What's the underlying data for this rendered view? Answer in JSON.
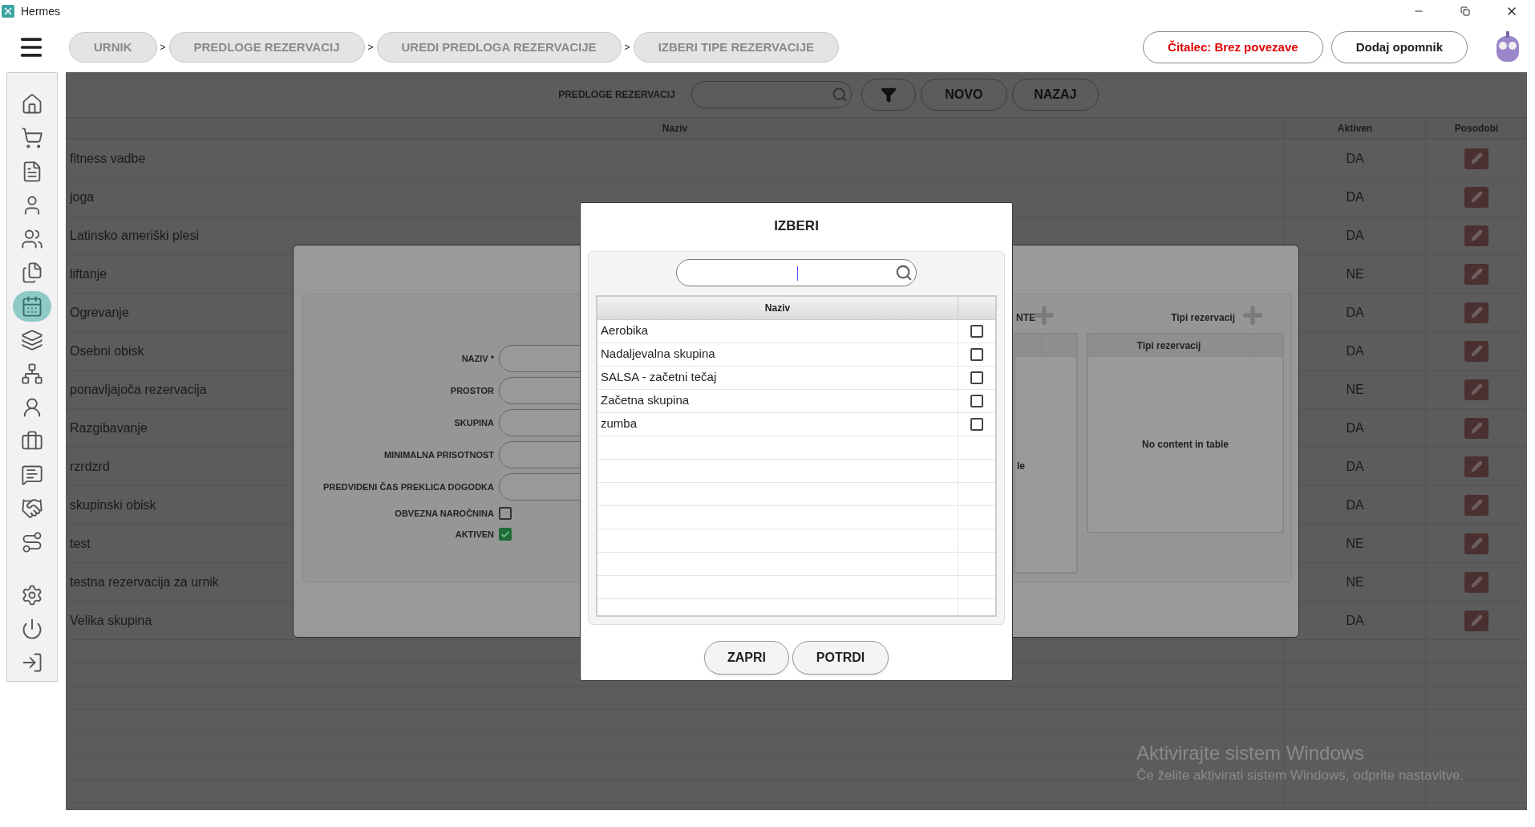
{
  "window": {
    "title": "Hermes"
  },
  "breadcrumbs": {
    "items": [
      {
        "label": "URNIK"
      },
      {
        "label": "PREDLOGE REZERVACIJ"
      },
      {
        "label": "UREDI PREDLOGA REZERVACIJE"
      },
      {
        "label": "IZBERI TIPE REZERVACIJE"
      }
    ],
    "separators": [
      ">",
      ">",
      ">"
    ]
  },
  "header_buttons": [
    {
      "label": "Čitalec: Brez povezave",
      "kind": "status"
    },
    {
      "label": "Dodaj opomnik",
      "kind": "plain"
    }
  ],
  "sidebar": {
    "items": [
      {
        "selected": false
      },
      {
        "selected": false
      },
      {
        "selected": false
      },
      {
        "selected": false
      },
      {
        "selected": false
      },
      {
        "selected": false
      },
      {
        "selected": true
      },
      {
        "selected": false
      },
      {
        "selected": false
      },
      {
        "selected": false
      },
      {
        "selected": false
      },
      {
        "selected": false
      },
      {
        "selected": false
      },
      {
        "selected": false
      },
      {
        "selected": false
      },
      {
        "selected": false
      },
      {
        "selected": false
      }
    ]
  },
  "toolbar": {
    "label": "PREDLOGE REZERVACIJ",
    "buttons": [
      "NOVO",
      "NAZAJ"
    ]
  },
  "table": {
    "columns": [
      "Naziv",
      "Aktiven",
      "Posodobi"
    ],
    "rows": [
      {
        "naziv": "fitness vadbe",
        "aktiven": "DA"
      },
      {
        "naziv": "joga",
        "aktiven": "DA"
      },
      {
        "naziv": "Latinsko ameriški plesi",
        "aktiven": "DA"
      },
      {
        "naziv": "liftanje",
        "aktiven": "NE"
      },
      {
        "naziv": "Ogrevanje",
        "aktiven": "DA"
      },
      {
        "naziv": "Osebni obisk",
        "aktiven": "DA"
      },
      {
        "naziv": "ponavljajoča rezervacija",
        "aktiven": "NE"
      },
      {
        "naziv": "Razgibavanje",
        "aktiven": "DA"
      },
      {
        "naziv": "rzrdzrd",
        "aktiven": "DA"
      },
      {
        "naziv": "skupinski obisk",
        "aktiven": "DA"
      },
      {
        "naziv": "test",
        "aktiven": "NE"
      },
      {
        "naziv": "testna rezervacija za urnik",
        "aktiven": "NE"
      },
      {
        "naziv": "Velika skupina",
        "aktiven": "DA"
      }
    ]
  },
  "edit_dialog": {
    "fields": [
      {
        "label": "NAZIV *",
        "kind": "text"
      },
      {
        "label": "PROSTOR",
        "kind": "text"
      },
      {
        "label": "SKUPINA",
        "kind": "text"
      },
      {
        "label": "MINIMALNA PRISOTNOST",
        "kind": "text"
      },
      {
        "label": "PREDVIDENI ČAS PREKLICA DOGODKA",
        "kind": "text"
      },
      {
        "label": "OBVEZNA NAROČNINA",
        "kind": "checkbox",
        "checked": false
      },
      {
        "label": "AKTIVEN",
        "kind": "checkbox",
        "checked": true
      }
    ],
    "partial_section_label": "NTE",
    "partial_table_text": "le",
    "types_section": {
      "label": "Tipi rezervacij",
      "column": "Tipi rezervacij",
      "empty_text": "No content in table"
    }
  },
  "select_dialog": {
    "title": "IZBERI",
    "column": "Naziv",
    "rows": [
      {
        "label": "Aerobika",
        "checked": false
      },
      {
        "label": "Nadaljevalna skupina",
        "checked": false
      },
      {
        "label": "SALSA - začetni tečaj",
        "checked": false
      },
      {
        "label": "Začetna skupina",
        "checked": false
      },
      {
        "label": "zumba",
        "checked": false
      }
    ],
    "buttons": [
      "ZAPRI",
      "POTRDI"
    ]
  },
  "activation_notice": {
    "title": "Aktivirajte sistem Windows",
    "text": "Če želite aktivirati sistem Windows, odprite nastavitve."
  }
}
